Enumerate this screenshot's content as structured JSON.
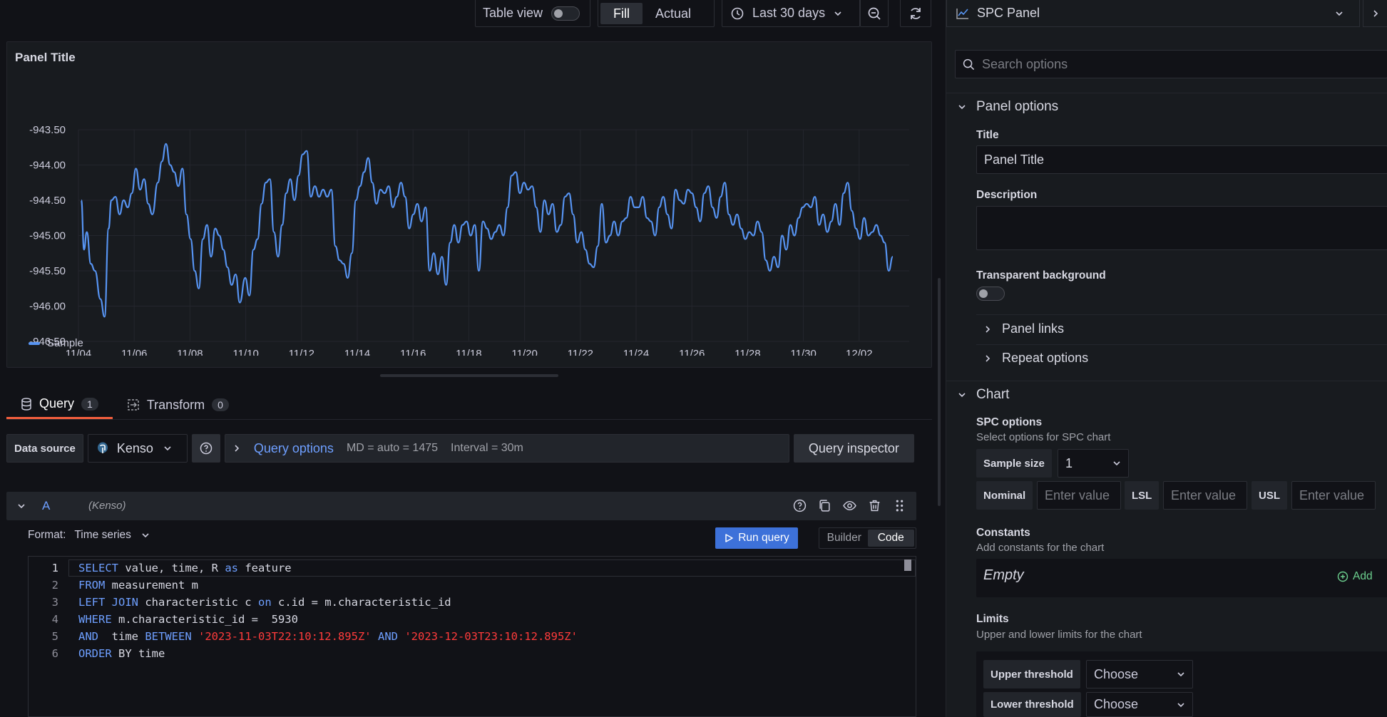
{
  "toolbar": {
    "table_view": "Table view",
    "fill": "Fill",
    "actual": "Actual",
    "time_range": "Last 30 days"
  },
  "panel": {
    "title": "Panel Title",
    "legend": "Sample"
  },
  "chart_data": {
    "type": "line",
    "title": "Panel Title",
    "ylim": [
      -946.5,
      -943.5
    ],
    "y_ticks": [
      "-943.50",
      "-944.00",
      "-944.50",
      "-945.00",
      "-945.50",
      "-946.00",
      "-946.50"
    ],
    "x_ticks": [
      "11/04",
      "11/06",
      "11/08",
      "11/10",
      "11/12",
      "11/14",
      "11/16",
      "11/18",
      "11/20",
      "11/22",
      "11/24",
      "11/26",
      "11/28",
      "11/30",
      "12/02"
    ],
    "grid": true,
    "legend": "bottom-left",
    "series": [
      {
        "name": "Sample",
        "color": "#5794f2",
        "x_days": [
          0,
          0.1,
          0.2,
          0.35,
          0.5,
          0.7,
          0.85,
          1.0,
          1.1,
          1.25,
          1.4,
          1.55,
          1.7,
          1.85,
          2.0,
          2.15,
          2.3,
          2.45,
          2.6,
          2.8,
          2.95,
          3.1,
          3.25,
          3.4,
          3.55,
          3.7,
          3.85,
          4.0,
          4.15,
          4.3,
          4.45,
          4.6,
          4.75,
          4.9,
          5.05,
          5.2,
          5.35,
          5.5,
          5.65,
          5.8,
          6.0,
          6.15,
          6.3,
          6.45,
          6.6,
          6.75,
          6.9,
          7.05,
          7.2,
          7.35,
          7.5,
          7.65,
          7.8,
          7.95,
          8.1,
          8.25,
          8.4,
          8.55,
          8.7,
          8.85,
          9.0,
          9.15,
          9.3,
          9.45,
          9.6,
          9.75,
          9.9,
          10.05,
          10.2,
          10.35,
          10.5,
          10.65,
          10.8,
          10.95,
          11.1,
          11.25,
          11.4,
          11.55,
          11.7,
          11.85,
          12.0,
          12.15,
          12.3,
          12.45,
          12.6,
          12.75,
          12.9,
          13.05,
          13.2,
          13.35,
          13.5,
          13.65,
          13.8,
          13.95,
          14.1,
          14.25,
          14.4,
          14.55,
          14.7,
          14.85,
          15.0,
          15.15,
          15.3,
          15.45,
          15.6,
          15.75,
          15.9,
          16.05,
          16.2,
          16.35,
          16.5,
          16.65,
          16.8,
          16.95,
          17.1,
          17.25,
          17.4,
          17.55,
          17.7,
          17.85,
          18.0,
          18.15,
          18.3,
          18.45,
          18.6,
          18.75,
          18.9,
          19.05,
          19.2,
          19.35,
          19.5,
          19.65,
          19.8,
          19.95,
          20.1,
          20.25,
          20.4,
          20.55,
          20.7,
          20.85,
          21.0,
          21.15,
          21.3,
          21.45,
          21.6,
          21.75,
          21.9,
          22.05,
          22.2,
          22.35,
          22.5,
          22.65,
          22.8,
          22.95,
          23.1,
          23.25,
          23.4,
          23.55,
          23.7,
          23.85,
          24.0,
          24.15,
          24.3,
          24.45,
          24.6,
          24.75,
          24.9,
          25.05,
          25.2,
          25.35,
          25.5,
          25.65,
          25.8,
          25.95,
          26.1,
          26.25,
          26.4,
          26.55,
          26.7,
          26.85,
          27.0,
          27.15,
          27.3,
          27.45,
          27.6,
          27.75,
          27.9,
          28.05,
          28.2,
          28.35,
          28.5,
          28.65,
          28.8,
          28.95,
          29.1,
          29.25,
          29.4,
          29.55,
          29.7,
          29.85,
          30.0
        ],
        "values": [
          -944.5,
          -945.2,
          -944.95,
          -945.4,
          -945.5,
          -945.9,
          -946.15,
          -944.9,
          -944.5,
          -944.45,
          -944.7,
          -944.5,
          -944.6,
          -944.4,
          -944.05,
          -944.35,
          -944.2,
          -944.55,
          -944.7,
          -944.25,
          -943.95,
          -943.7,
          -944.0,
          -944.1,
          -944.3,
          -944.05,
          -944.7,
          -945.05,
          -945.5,
          -945.75,
          -945.05,
          -944.85,
          -945.3,
          -944.9,
          -945.0,
          -945.2,
          -945.45,
          -945.7,
          -945.55,
          -945.95,
          -945.6,
          -945.85,
          -945.2,
          -945.05,
          -944.55,
          -944.25,
          -944.2,
          -944.95,
          -945.3,
          -944.85,
          -944.4,
          -944.2,
          -944.5,
          -944.15,
          -943.85,
          -943.8,
          -944.45,
          -944.3,
          -944.45,
          -944.35,
          -944.45,
          -944.35,
          -945.15,
          -945.35,
          -945.4,
          -945.6,
          -945.25,
          -944.5,
          -944.3,
          -944.1,
          -943.9,
          -944.25,
          -944.55,
          -944.35,
          -944.4,
          -944.3,
          -944.6,
          -944.45,
          -944.25,
          -944.45,
          -944.9,
          -944.7,
          -944.55,
          -944.8,
          -944.6,
          -945.5,
          -945.25,
          -945.55,
          -945.3,
          -945.7,
          -945.1,
          -944.85,
          -945.1,
          -944.85,
          -944.8,
          -945.0,
          -944.85,
          -945.5,
          -944.8,
          -944.9,
          -945.05,
          -944.95,
          -944.85,
          -945.0,
          -944.6,
          -944.15,
          -944.1,
          -944.4,
          -944.25,
          -944.35,
          -944.3,
          -944.6,
          -944.95,
          -944.5,
          -944.7,
          -944.55,
          -944.95,
          -944.85,
          -944.45,
          -944.4,
          -944.7,
          -945.1,
          -944.95,
          -945.2,
          -945.4,
          -945.45,
          -945.15,
          -944.55,
          -945.1,
          -945.0,
          -944.8,
          -945.0,
          -944.8,
          -944.75,
          -944.45,
          -944.6,
          -944.6,
          -944.45,
          -944.75,
          -944.8,
          -945.0,
          -944.6,
          -944.45,
          -944.7,
          -944.9,
          -944.35,
          -944.5,
          -944.55,
          -944.35,
          -944.4,
          -944.6,
          -944.8,
          -944.4,
          -944.3,
          -944.6,
          -944.75,
          -944.45,
          -944.25,
          -944.7,
          -944.85,
          -944.7,
          -944.9,
          -945.05,
          -944.95,
          -945.0,
          -944.8,
          -944.95,
          -945.35,
          -945.5,
          -945.3,
          -945.45,
          -945.0,
          -945.2,
          -944.85,
          -945.0,
          -944.75,
          -944.6,
          -944.55,
          -944.6,
          -944.45,
          -944.85,
          -944.7,
          -944.95,
          -944.8,
          -944.55,
          -944.85,
          -944.4,
          -944.25,
          -944.65,
          -944.9,
          -945.05,
          -944.75,
          -945.0,
          -944.95,
          -944.85,
          -945.0,
          -945.1,
          -945.5,
          -945.3
        ]
      }
    ]
  },
  "query": {
    "tab_query": "Query",
    "tab_query_count": "1",
    "tab_transform": "Transform",
    "tab_transform_count": "0",
    "data_source_label": "Data source",
    "data_source": "Kenso",
    "query_options": "Query options",
    "md": "MD = auto = 1475",
    "interval": "Interval = 30m",
    "inspector": "Query inspector",
    "ref_id": "A",
    "ds_name": "(Kenso)",
    "format_label": "Format:",
    "format_value": "Time series",
    "run_query": "Run query",
    "builder": "Builder",
    "code": "Code",
    "lines": [
      {
        "n": "1",
        "segs": [
          [
            "kw",
            "SELECT"
          ],
          [
            "fn",
            " value, time, R "
          ],
          [
            "kw",
            "as"
          ],
          [
            "fn",
            " feature"
          ]
        ]
      },
      {
        "n": "2",
        "segs": [
          [
            "kw",
            "FROM"
          ],
          [
            "fn",
            " measurement m"
          ]
        ]
      },
      {
        "n": "3",
        "segs": [
          [
            "kw",
            "LEFT JOIN"
          ],
          [
            "fn",
            " characteristic c "
          ],
          [
            "kw",
            "on"
          ],
          [
            "fn",
            " c.id = m.characteristic_id"
          ]
        ]
      },
      {
        "n": "4",
        "segs": [
          [
            "kw",
            "WHERE"
          ],
          [
            "fn",
            " m.characteristic_id =  5930"
          ]
        ]
      },
      {
        "n": "5",
        "segs": [
          [
            "kw",
            "AND"
          ],
          [
            "fn",
            "  time "
          ],
          [
            "kw",
            "BETWEEN"
          ],
          [
            "fn",
            " "
          ],
          [
            "str",
            "'2023-11-03T22:10:12.895Z'"
          ],
          [
            "fn",
            " "
          ],
          [
            "kw",
            "AND"
          ],
          [
            "fn",
            " "
          ],
          [
            "str",
            "'2023-12-03T23:10:12.895Z'"
          ]
        ]
      },
      {
        "n": "6",
        "segs": [
          [
            "kw",
            "ORDER"
          ],
          [
            "fn",
            " BY time"
          ]
        ]
      }
    ]
  },
  "options": {
    "viz_name": "SPC Panel",
    "search_placeholder": "Search options",
    "panel_options": "Panel options",
    "title_label": "Title",
    "title_value": "Panel Title",
    "description_label": "Description",
    "transparent_label": "Transparent background",
    "panel_links": "Panel links",
    "repeat_options": "Repeat options",
    "chart": "Chart",
    "spc_options": "SPC options",
    "spc_sub": "Select options for SPC chart",
    "sample_size_label": "Sample size",
    "sample_size_value": "1",
    "nominal": "Nominal",
    "lsl": "LSL",
    "usl": "USL",
    "enter_value": "Enter value",
    "constants": "Constants",
    "constants_sub": "Add constants for the chart",
    "empty": "Empty",
    "add": "Add",
    "limits": "Limits",
    "limits_sub": "Upper and lower limits for the chart",
    "upper_threshold": "Upper threshold",
    "lower_threshold": "Lower threshold",
    "choose": "Choose"
  }
}
